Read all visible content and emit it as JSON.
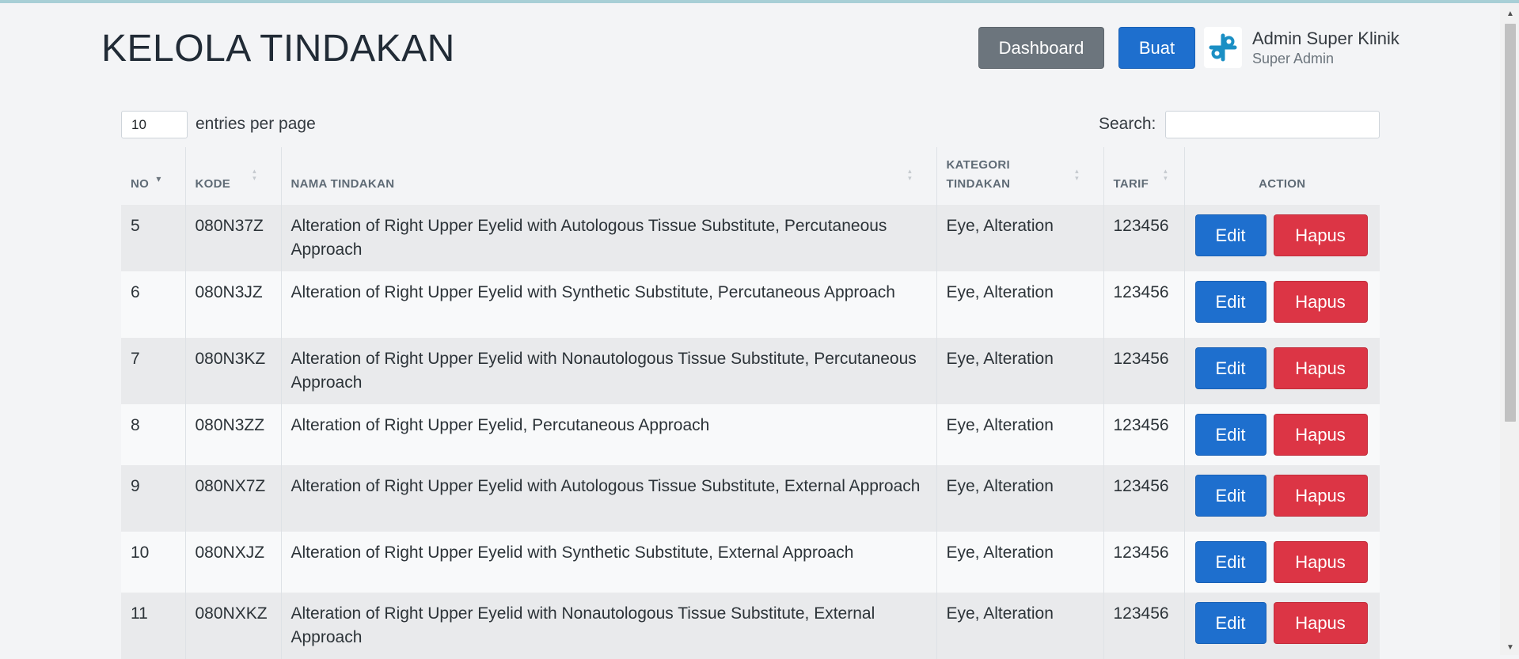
{
  "header": {
    "title": "KELOLA TINDAKAN",
    "dashboard_label": "Dashboard",
    "create_label": "Buat",
    "user_name": "Admin Super Klinik",
    "user_role": "Super Admin"
  },
  "controls": {
    "entries_value": "10",
    "entries_label": "entries per page",
    "search_label": "Search:",
    "search_value": ""
  },
  "table": {
    "columns": {
      "no": "NO",
      "kode": "KODE",
      "nama": "NAMA TINDAKAN",
      "kategori": "KATEGORI TINDAKAN",
      "tarif": "TARIF",
      "action": "ACTION"
    },
    "edit_label": "Edit",
    "delete_label": "Hapus",
    "rows": [
      {
        "no": "5",
        "kode": "080N37Z",
        "nama": "Alteration of Right Upper Eyelid with Autologous Tissue Substitute, Percutaneous Approach",
        "kategori": "Eye, Alteration",
        "tarif": "123456"
      },
      {
        "no": "6",
        "kode": "080N3JZ",
        "nama": "Alteration of Right Upper Eyelid with Synthetic Substitute, Percutaneous Approach",
        "kategori": "Eye, Alteration",
        "tarif": "123456"
      },
      {
        "no": "7",
        "kode": "080N3KZ",
        "nama": "Alteration of Right Upper Eyelid with Nonautologous Tissue Substitute, Percutaneous Approach",
        "kategori": "Eye, Alteration",
        "tarif": "123456"
      },
      {
        "no": "8",
        "kode": "080N3ZZ",
        "nama": "Alteration of Right Upper Eyelid, Percutaneous Approach",
        "kategori": "Eye, Alteration",
        "tarif": "123456"
      },
      {
        "no": "9",
        "kode": "080NX7Z",
        "nama": "Alteration of Right Upper Eyelid with Autologous Tissue Substitute, External Approach",
        "kategori": "Eye, Alteration",
        "tarif": "123456"
      },
      {
        "no": "10",
        "kode": "080NXJZ",
        "nama": "Alteration of Right Upper Eyelid with Synthetic Substitute, External Approach",
        "kategori": "Eye, Alteration",
        "tarif": "123456"
      },
      {
        "no": "11",
        "kode": "080NXKZ",
        "nama": "Alteration of Right Upper Eyelid with Nonautologous Tissue Substitute, External Approach",
        "kategori": "Eye, Alteration",
        "tarif": "123456"
      }
    ]
  },
  "colors": {
    "primary": "#1e6fce",
    "secondary": "#6c757d",
    "danger": "#dc3545",
    "logo": "#1b8fc4"
  },
  "icons": {
    "logo": "clinic-logo-icon",
    "sort_none": "sort-both-icon",
    "sort_desc": "sort-desc-icon"
  }
}
